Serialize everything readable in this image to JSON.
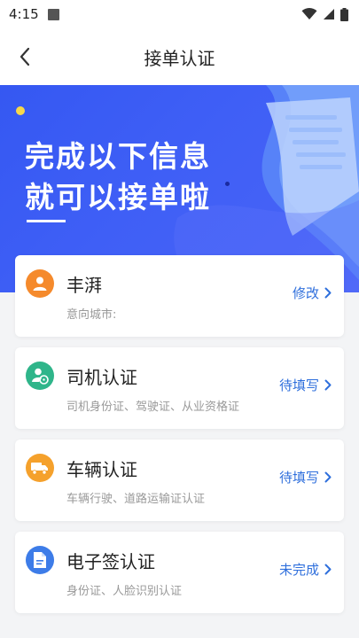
{
  "status_bar": {
    "time": "4:15"
  },
  "header": {
    "title": "接单认证"
  },
  "banner": {
    "line1": "完成以下信息",
    "line2": "就可以接单啦"
  },
  "cards": [
    {
      "title": "丰湃",
      "subtitle": "意向城市:",
      "action": "修改",
      "icon": "person-icon",
      "icon_color": "#f58a2c"
    },
    {
      "title": "司机认证",
      "subtitle": "司机身份证、驾驶证、从业资格证",
      "action": "待填写",
      "icon": "driver-icon",
      "icon_color": "#2fb58a"
    },
    {
      "title": "车辆认证",
      "subtitle": "车辆行驶、道路运输证认证",
      "action": "待填写",
      "icon": "truck-icon",
      "icon_color": "#f5a12c"
    },
    {
      "title": "电子签认证",
      "subtitle": "身份证、人脸识别认证",
      "action": "未完成",
      "icon": "document-icon",
      "icon_color": "#3d7ce8"
    }
  ],
  "colors": {
    "accent": "#2f6fdc",
    "banner": "#3f5ff6"
  }
}
